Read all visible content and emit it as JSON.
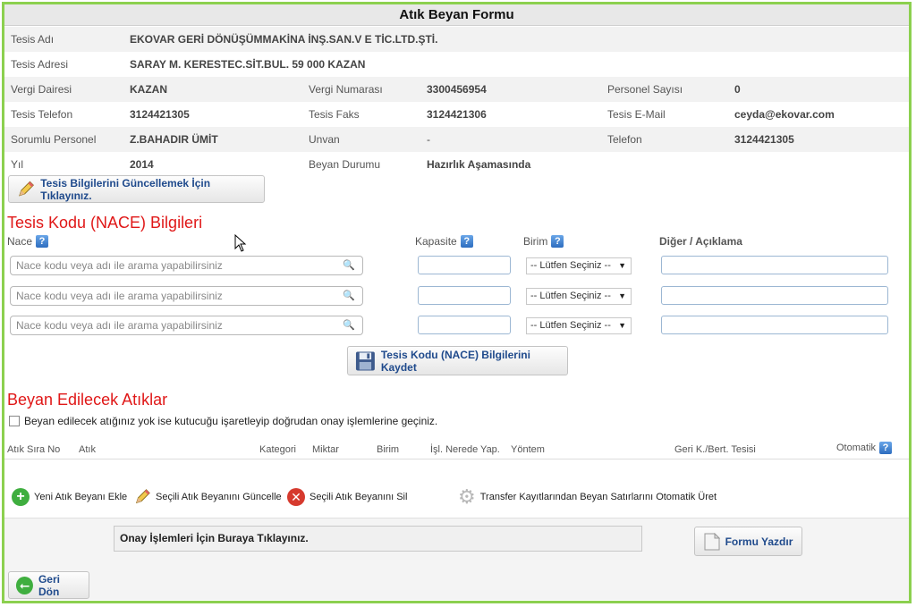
{
  "title": "Atık Beyan Formu",
  "facility": {
    "name_label": "Tesis Adı",
    "name": "EKOVAR GERİ DÖNÜŞÜMMAKİNA İNŞ.SAN.V E TİC.LTD.ŞTİ.",
    "address_label": "Tesis Adresi",
    "address": "SARAY M. KERESTEC.SİT.BUL. 59 000 KAZAN",
    "tax_office_label": "Vergi Dairesi",
    "tax_office": "KAZAN",
    "tax_no_label": "Vergi Numarası",
    "tax_no": "3300456954",
    "staff_count_label": "Personel Sayısı",
    "staff_count": "0",
    "phone_label": "Tesis Telefon",
    "phone": "3124421305",
    "fax_label": "Tesis Faks",
    "fax": "3124421306",
    "email_label": "Tesis E-Mail",
    "email": "ceyda@ekovar.com",
    "responsible_label": "Sorumlu Personel",
    "responsible": "Z.BAHADIR ÜMİT",
    "title_label": "Unvan",
    "title_value": "-",
    "contact_phone_label": "Telefon",
    "contact_phone": "3124421305",
    "year_label": "Yıl",
    "year": "2014",
    "status_label": "Beyan Durumu",
    "status": "Hazırlık Aşamasında"
  },
  "update_button": "Tesis Bilgilerini Güncellemek İçin Tıklayınız.",
  "nace": {
    "section_title": "Tesis Kodu (NACE) Bilgileri",
    "col_nace": "Nace",
    "col_capacity": "Kapasite",
    "col_unit": "Birim",
    "col_other": "Diğer / Açıklama",
    "search_placeholder": "Nace kodu veya adı ile arama yapabilirsiniz",
    "unit_select": "-- Lütfen Seçiniz --",
    "save_button": "Tesis Kodu (NACE) Bilgilerini Kaydet"
  },
  "waste": {
    "section_title": "Beyan Edilecek Atıklar",
    "checkbox_label": "Beyan edilecek atığınız yok ise kutucuğu işaretleyip doğrudan onay işlemlerine geçiniz.",
    "columns": [
      "Atık Sıra No",
      "Atık",
      "Kategori",
      "Miktar",
      "Birim",
      "İşl. Nerede Yap.",
      "Yöntem",
      "Geri K./Bert. Tesisi",
      "Otomatik"
    ]
  },
  "actions": {
    "add": "Yeni Atık Beyanı Ekle",
    "update": "Seçili Atık Beyanını Güncelle",
    "delete": "Seçili Atık Beyanını Sil",
    "auto": "Transfer Kayıtlarından Beyan Satırlarını Otomatik Üret"
  },
  "approval_link": "Onay İşlemleri İçin Buraya Tıklayınız.",
  "print_button": "Formu Yazdır",
  "back_button": "Geri Dön",
  "help_glyph": "?",
  "colors": {
    "accent_green": "#8cd04f",
    "section_red": "#e01818",
    "link_blue": "#1f4a8c"
  }
}
